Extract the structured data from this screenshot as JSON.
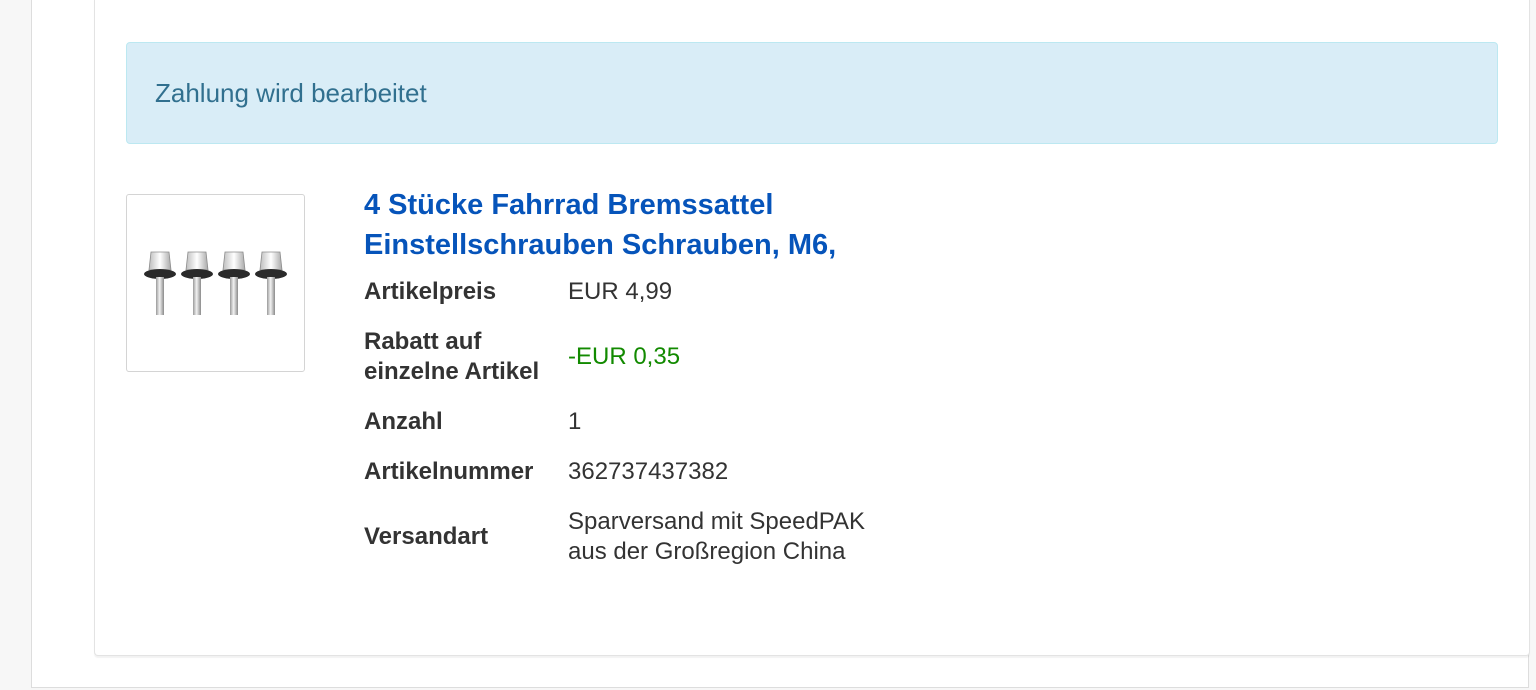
{
  "status": {
    "text": "Zahlung wird bearbeitet"
  },
  "item": {
    "image_icon": "screws-product-image",
    "title": "4 Stücke Fahrrad Bremssattel Einstellschrauben Schrauben, M6,",
    "rows": [
      {
        "label": "Artikelpreis",
        "value": "EUR 4,99"
      },
      {
        "label": "Rabatt auf einzelne Artikel",
        "value": "-EUR 0,35"
      },
      {
        "label": "Anzahl",
        "value": "1"
      },
      {
        "label": "Artikelnummer",
        "value": "362737437382"
      },
      {
        "label": "Versandart",
        "value": "Sparversand mit SpeedPAK aus der Großregion China"
      }
    ]
  },
  "colors": {
    "link": "#0654ba",
    "discount": "#128a00",
    "info_bg": "#d9edf7",
    "info_text": "#31708f"
  }
}
